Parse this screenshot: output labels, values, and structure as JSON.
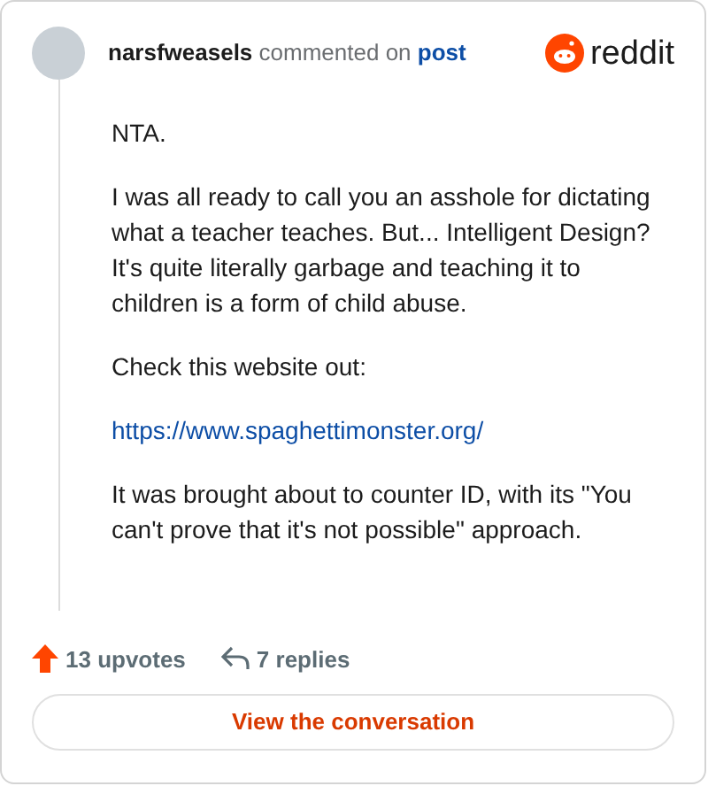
{
  "header": {
    "author": "narsfweasels",
    "action": "commented on",
    "target": "post",
    "logo_text": "reddit"
  },
  "comment": {
    "paragraphs": [
      {
        "kind": "text",
        "text": "NTA."
      },
      {
        "kind": "text",
        "text": "I was all ready to call you an asshole for dictating what a teacher teaches. But... Intelligent Design? It's quite literally garbage and teaching it to children is a form of child abuse."
      },
      {
        "kind": "text",
        "text": "Check this website out:"
      },
      {
        "kind": "link",
        "text": "https://www.spaghettimonster.org/"
      },
      {
        "kind": "text",
        "text": "It was brought about to counter ID, with its \"You can't prove that it's not possible\" approach."
      }
    ]
  },
  "stats": {
    "upvotes": "13 upvotes",
    "replies": "7 replies"
  },
  "button": "View the conversation"
}
